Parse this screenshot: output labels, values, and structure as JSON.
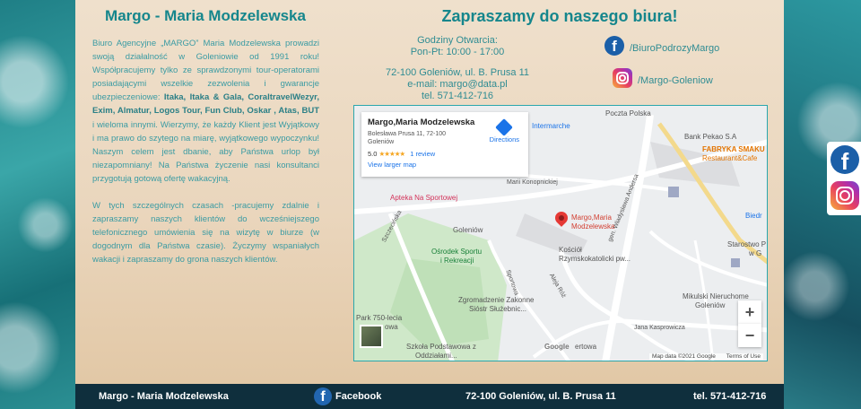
{
  "left": {
    "title": "Margo - Maria Modzelewska",
    "desc1_intro": "Biuro Agencyjne „MARGO” Maria Modzelewska prowadzi swoją działalność w Goleniowie od 1991 roku! Współpracujemy tylko ze sprawdzonymi tour-operatorami posiadającymi wszelkie zezwolenia i gwarancje ubezpieczeniowe: ",
    "desc1_bold": "Itaka, Itaka & Gala, CoraltravelWezyr, Exim, Almatur, Logos Tour, Fun Club, Oskar , Atas, BUT",
    "desc1_rest": " i wieloma innymi. Wierzymy, że każdy Klient jest Wyjątkowy i ma prawo do szytego na miarę, wyjątkowego wypoczynku! Naszym celem jest dbanie, aby Państwa urlop był niezapomniany! Na Państwa życzenie nasi konsultanci przygotują gotową ofertę wakacyjną.",
    "desc2": "W tych szczególnych czasach -pracujemy zdalnie i zapraszamy naszych klientów do wcześniejszego telefonicznego umówienia się na wizytę w biurze (w dogodnym dla Państwa czasie). Życzymy wspaniałych wakacji i zapraszamy do grona naszych klientów."
  },
  "right": {
    "title": "Zapraszamy do naszego biura!",
    "hours_label": "Godziny Otwarcia:",
    "hours": "Pon-Pt: 10:00 - 17:00",
    "address": "72-100 Goleniów, ul. B. Prusa 11",
    "email": "e-mail: margo@data.pl",
    "phone": "tel. 571-412-716",
    "facebook_label": "/BiuroPodrozyMargo",
    "instagram_label": "/Margo-Goleniow"
  },
  "map": {
    "card_name": "Margo,Maria Modzelewska",
    "card_address": "Bolesława Prusa 11, 72-100 Goleniów",
    "card_rating": "5.0",
    "card_stars": "★★★★★",
    "card_reviews": "1 review",
    "card_larger": "View larger map",
    "card_directions": "Directions",
    "labels": {
      "poczta": "Poczta Polska",
      "intermarche": "Intermarche",
      "pekao": "Bank Pekao S.A",
      "fabryka1": "FABRYKA SMAKU",
      "fabryka2": "Restaurant&Cafe",
      "konopnickiej": "Marii Konopnickiej",
      "apteka": "Apteka Na Sportowej",
      "pin1": "Margo,Maria",
      "pin2": "Modzelewska",
      "goleniow": "Goleniów",
      "osrodek1": "Ośrodek Sportu",
      "osrodek2": "i Rekreacji",
      "kosciol1": "Kościół",
      "kosciol2": "Rzymskokatolicki pw...",
      "starostwo": "Starostwo P",
      "starostwo2": "w G",
      "biedr": "Biedr",
      "mikulski1": "Mikulski Nieruchome",
      "mikulski2": "Goleniów",
      "zgromadzenie1": "Zgromadzenie Zakonne",
      "zgromadzenie2": "Sióstr Służebnic...",
      "park1": "Park 750-lecia",
      "park2": "owa",
      "szkola1": "Szkoła Podstawowa z",
      "szkola2": "Oddziałami...",
      "kasprowicza": "Jana Kasprowicza",
      "andersa": "gen. Władysława Andersa",
      "szczecinska": "Szczecińska",
      "sportowa": "Sportowa",
      "roz": "Aleja Róż",
      "google": "Google",
      "ertowa": "ertowa"
    },
    "zoom_in": "+",
    "zoom_out": "−",
    "footer_data": "Map data ©2021 Google",
    "footer_terms": "Terms of Use"
  },
  "footer": {
    "name": "Margo - Maria Modzelewska",
    "facebook": "Facebook",
    "address": "72-100 Goleniów, ul. B. Prusa 11",
    "phone": "tel. 571-412-716"
  },
  "icons": {
    "facebook_glyph": "f"
  },
  "colors": {
    "accent": "#15868c",
    "footer_bg": "#0f2f3d",
    "facebook": "#1b5fa8"
  }
}
